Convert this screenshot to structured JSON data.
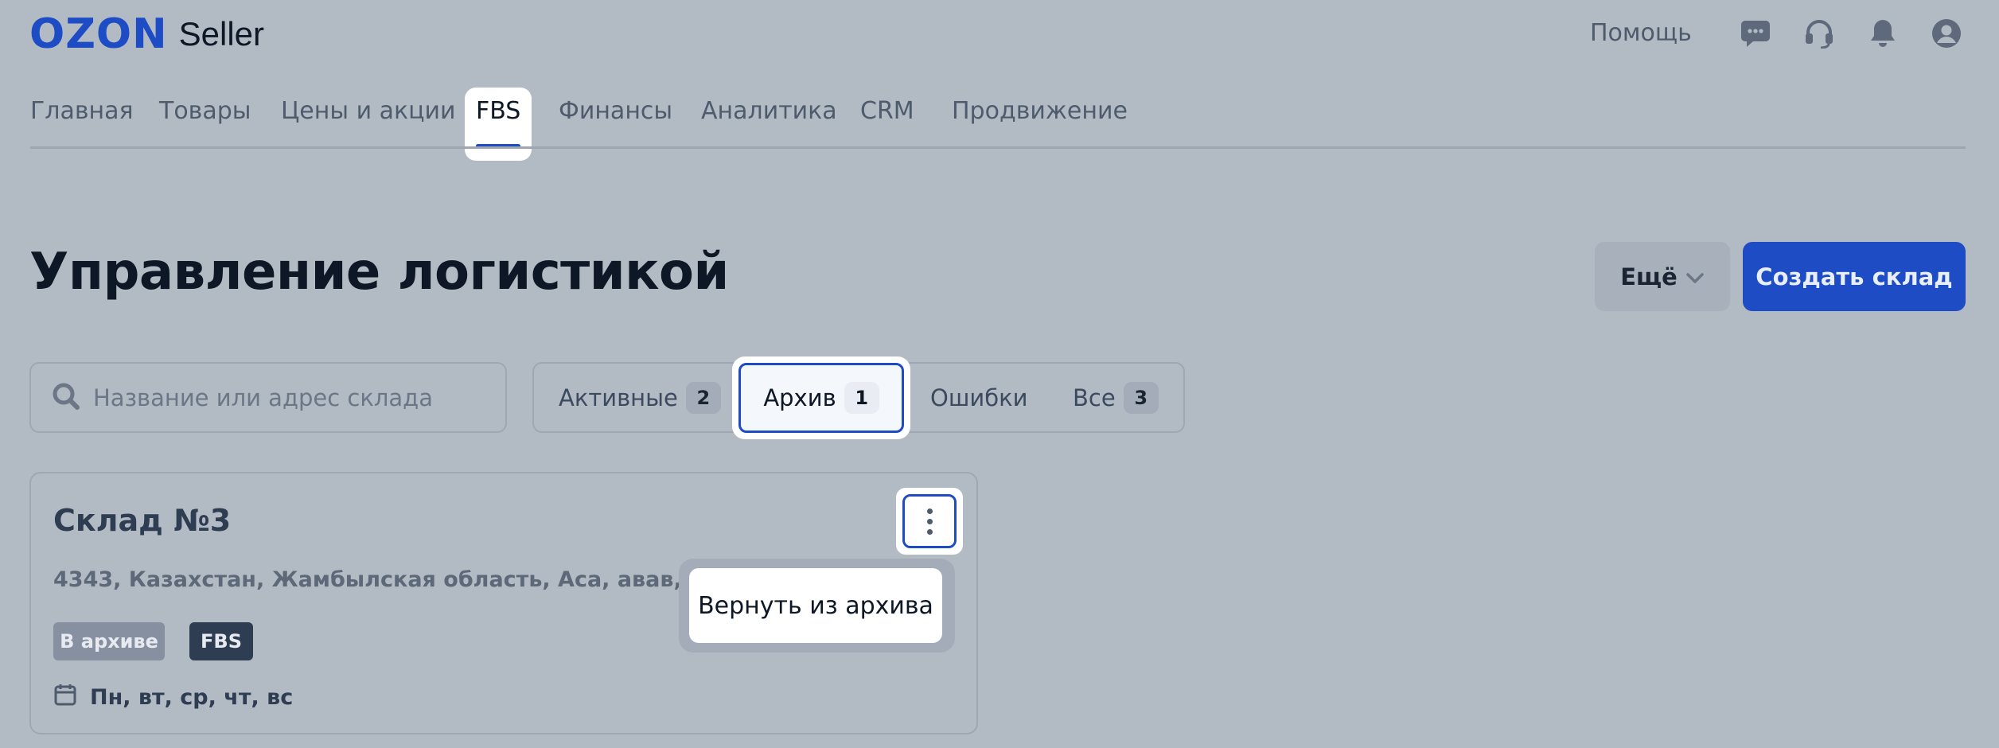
{
  "header": {
    "logo_brand": "OZON",
    "logo_product": "Seller",
    "help_label": "Помощь",
    "icons": [
      "chat-icon",
      "headset-icon",
      "bell-icon",
      "user-icon"
    ]
  },
  "nav": {
    "items": [
      {
        "label": "Главная",
        "active": false
      },
      {
        "label": "Товары",
        "active": false
      },
      {
        "label": "Цены и акции",
        "active": false
      },
      {
        "label": "FBS",
        "active": true
      },
      {
        "label": "Финансы",
        "active": false
      },
      {
        "label": "Аналитика",
        "active": false
      },
      {
        "label": "CRM",
        "active": false
      },
      {
        "label": "Продвижение",
        "active": false
      }
    ]
  },
  "page": {
    "title": "Управление логистикой",
    "more_label": "Ещё",
    "create_label": "Создать склад"
  },
  "search": {
    "placeholder": "Название или адрес склада",
    "value": ""
  },
  "filters": {
    "tabs": [
      {
        "label": "Активные",
        "count": "2",
        "active": false
      },
      {
        "label": "Архив",
        "count": "1",
        "active": true
      },
      {
        "label": "Ошибки",
        "count": null,
        "active": false
      },
      {
        "label": "Все",
        "count": "3",
        "active": false
      }
    ]
  },
  "warehouse": {
    "title": "Склад №3",
    "address": "4343, Казахстан, Жамбылская область, Аса, авав, 43",
    "tags": [
      "В архиве",
      "FBS"
    ],
    "schedule": "Пн, вт, ср, чт, вс"
  },
  "context_menu": {
    "items": [
      "Вернуть из архива"
    ]
  },
  "colors": {
    "accent": "#1d4cc5",
    "background_overlay": "#b2bac4",
    "text_dark": "#0e1725"
  }
}
